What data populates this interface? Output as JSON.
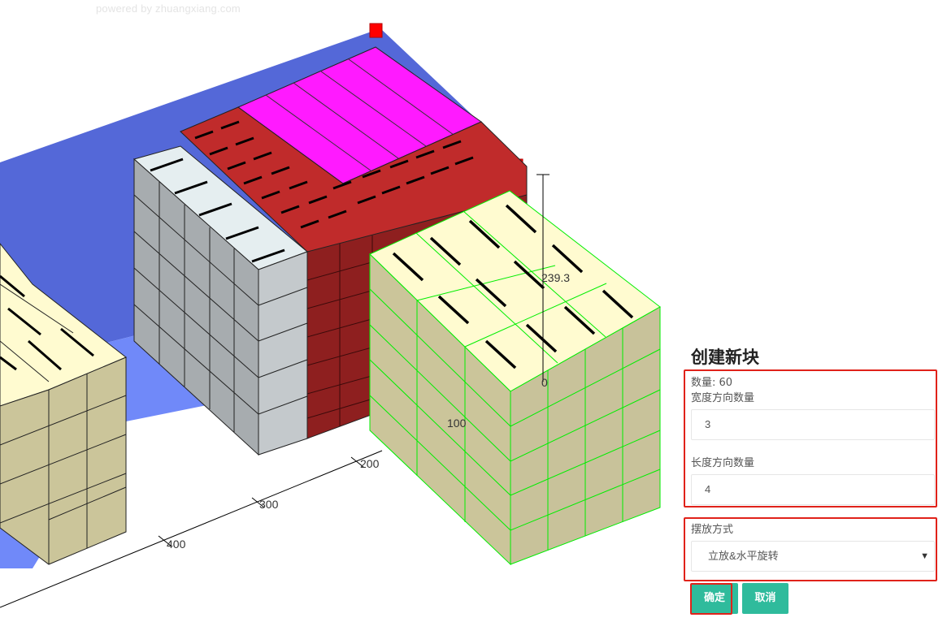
{
  "watermark": "powered by zhuangxiang.com",
  "scene": {
    "axis_labels": [
      "200",
      "300",
      "400"
    ],
    "dimension_labels": [
      "239.3",
      "0",
      "100"
    ],
    "colors": {
      "container_wall": "#5468d8",
      "container_floor": "#7088f8",
      "marker": "#ff0000",
      "magenta_block": "#ff19ff",
      "red_block": "#b52a2a",
      "grey_block": "#b9bdbf",
      "cream_block": "#fffbd0",
      "selection_edge": "#00ee00"
    }
  },
  "dialog": {
    "title": "创建新块",
    "quantity_text": "数量: 60",
    "width_label": "宽度方向数量",
    "width_value": "3",
    "length_label": "长度方向数量",
    "length_value": "4",
    "placement_label": "摆放方式",
    "placement_value": "立放&水平旋转",
    "confirm_label": "确定",
    "cancel_label": "取消"
  }
}
